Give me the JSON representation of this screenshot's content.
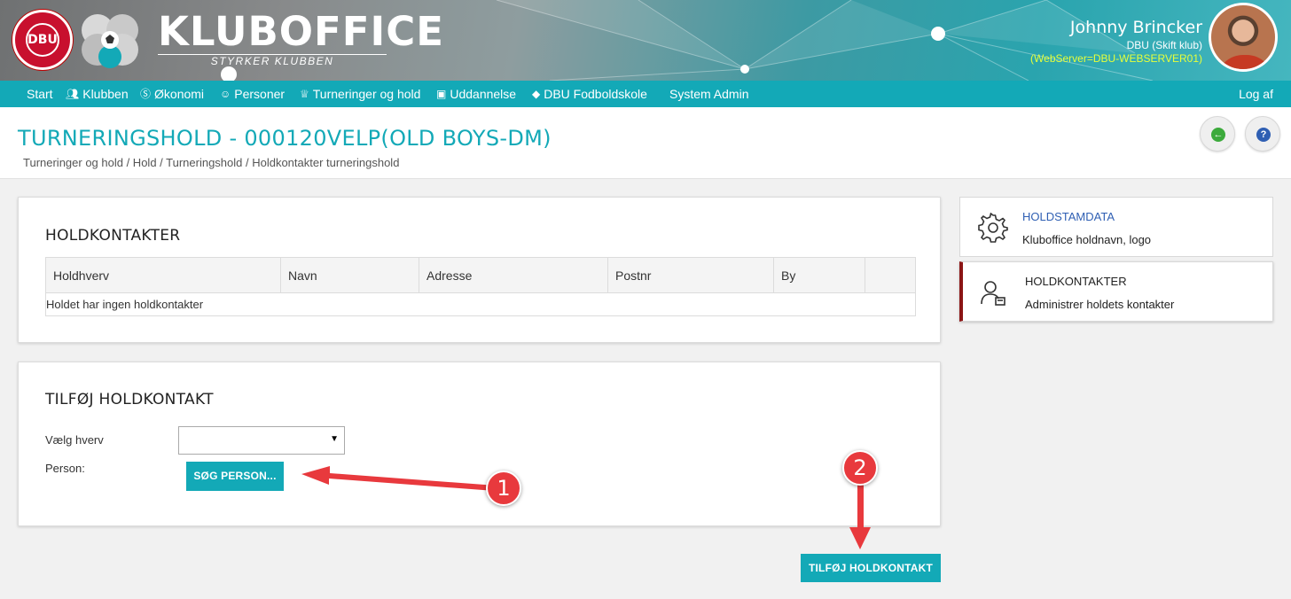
{
  "header": {
    "dbu_logo_text": "DBU",
    "brand_title": "KLUBOFFICE",
    "brand_tagline": "STYRKER KLUBBEN",
    "user_name": "Johnny Brincker",
    "user_club": "DBU (Skift klub)",
    "user_server": "(WebServer=DBU-WEBSERVER01)"
  },
  "nav": {
    "items": [
      {
        "label": "Start",
        "icon": ""
      },
      {
        "label": "Klubben",
        "icon": "people-icon"
      },
      {
        "label": "Økonomi",
        "icon": "money-icon"
      },
      {
        "label": "Personer",
        "icon": "person-icon"
      },
      {
        "label": "Turneringer og hold",
        "icon": "trophy-icon"
      },
      {
        "label": "Uddannelse",
        "icon": "presentation-icon"
      },
      {
        "label": "DBU Fodboldskole",
        "icon": "graduation-cap-icon"
      },
      {
        "label": "System Admin",
        "icon": ""
      }
    ],
    "logout": "Log af"
  },
  "page": {
    "title": "TURNERINGSHOLD - 000120VELP(OLD BOYS-DM)",
    "breadcrumb": "Turneringer og hold / Hold / Turneringshold / Holdkontakter turneringshold"
  },
  "contacts_panel": {
    "heading": "HOLDKONTAKTER",
    "columns": [
      "Holdhverv",
      "Navn",
      "Adresse",
      "Postnr",
      "By",
      ""
    ],
    "empty_text": "Holdet har ingen holdkontakter"
  },
  "add_panel": {
    "heading": "TILFØJ HOLDKONTAKT",
    "role_label": "Vælg hverv",
    "role_value": "",
    "person_label": "Person:",
    "search_button": "SØG PERSON..."
  },
  "submit_button": "TILFØJ HOLDKONTAKT",
  "side_cards": [
    {
      "title": "HOLDSTAMDATA",
      "subtitle": "Kluboffice holdnavn, logo",
      "icon": "gear-icon",
      "active": false
    },
    {
      "title": "HOLDKONTAKTER",
      "subtitle": "Administrer holdets kontakter",
      "icon": "contact-person-icon",
      "active": true
    }
  ],
  "annotations": [
    "1",
    "2"
  ],
  "colors": {
    "accent": "#13a9b7",
    "active_marker": "#8b1414",
    "annotation": "#e8393d",
    "server_text": "#e6ff3a"
  }
}
